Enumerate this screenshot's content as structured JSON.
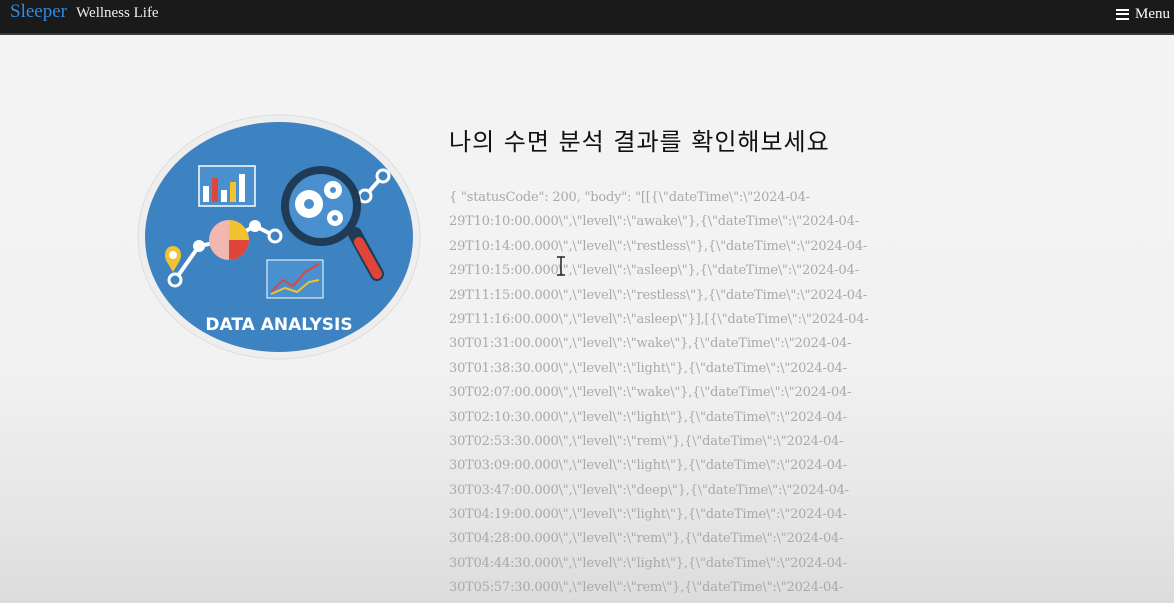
{
  "navbar": {
    "brand_name": "Sleeper",
    "brand_sub": "Wellness Life",
    "menu_label": "Menu"
  },
  "illustration": {
    "caption": "DATA ANALYSIS",
    "colors": {
      "circle": "#3d83c2",
      "ring": "#eaeaea",
      "accent_red": "#e0453a",
      "accent_yellow": "#f1c232",
      "magnifier": "#1f3b56"
    }
  },
  "main": {
    "heading": "나의 수면 분석 결과를 확인해보세요",
    "json_lines": [
      "{ \"statusCode\": 200, \"body\": \"[[{\\\"dateTime\\\":\\\"2024-04-",
      "29T10:10:00.000\\\",\\\"level\\\":\\\"awake\\\"},{\\\"dateTime\\\":\\\"2024-04-",
      "29T10:14:00.000\\\",\\\"level\\\":\\\"restless\\\"},{\\\"dateTime\\\":\\\"2024-04-",
      "29T10:15:00.000\\\",\\\"level\\\":\\\"asleep\\\"},{\\\"dateTime\\\":\\\"2024-04-",
      "29T11:15:00.000\\\",\\\"level\\\":\\\"restless\\\"},{\\\"dateTime\\\":\\\"2024-04-",
      "29T11:16:00.000\\\",\\\"level\\\":\\\"asleep\\\"}],[{\\\"dateTime\\\":\\\"2024-04-",
      "30T01:31:00.000\\\",\\\"level\\\":\\\"wake\\\"},{\\\"dateTime\\\":\\\"2024-04-",
      "30T01:38:30.000\\\",\\\"level\\\":\\\"light\\\"},{\\\"dateTime\\\":\\\"2024-04-",
      "30T02:07:00.000\\\",\\\"level\\\":\\\"wake\\\"},{\\\"dateTime\\\":\\\"2024-04-",
      "30T02:10:30.000\\\",\\\"level\\\":\\\"light\\\"},{\\\"dateTime\\\":\\\"2024-04-",
      "30T02:53:30.000\\\",\\\"level\\\":\\\"rem\\\"},{\\\"dateTime\\\":\\\"2024-04-",
      "30T03:09:00.000\\\",\\\"level\\\":\\\"light\\\"},{\\\"dateTime\\\":\\\"2024-04-",
      "30T03:47:00.000\\\",\\\"level\\\":\\\"deep\\\"},{\\\"dateTime\\\":\\\"2024-04-",
      "30T04:19:00.000\\\",\\\"level\\\":\\\"light\\\"},{\\\"dateTime\\\":\\\"2024-04-",
      "30T04:28:00.000\\\",\\\"level\\\":\\\"rem\\\"},{\\\"dateTime\\\":\\\"2024-04-",
      "30T04:44:30.000\\\",\\\"level\\\":\\\"light\\\"},{\\\"dateTime\\\":\\\"2024-04-",
      "30T05:57:30.000\\\",\\\"level\\\":\\\"rem\\\"},{\\\"dateTime\\\":\\\"2024-04-"
    ]
  }
}
